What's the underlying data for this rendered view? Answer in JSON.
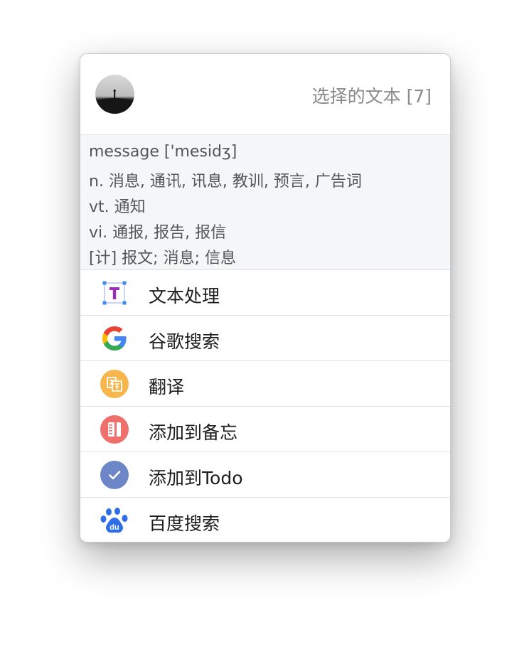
{
  "header": {
    "title": "选择的文本 [7]",
    "avatar_icon": "avatar-silhouette-icon"
  },
  "dictionary": {
    "lines": [
      "message ['mesidʒ]",
      "n. 消息, 通讯, 讯息, 教训, 预言, 广告词",
      "vt. 通知",
      "vi. 通报, 报告, 报信",
      "[计] 报文; 消息; 信息"
    ]
  },
  "menu": {
    "items": [
      {
        "label": "文本处理",
        "icon": "text-processing-icon"
      },
      {
        "label": "谷歌搜索",
        "icon": "google-icon"
      },
      {
        "label": "翻译",
        "icon": "translate-icon"
      },
      {
        "label": "添加到备忘",
        "icon": "memo-icon"
      },
      {
        "label": "添加到Todo",
        "icon": "todo-check-icon"
      },
      {
        "label": "百度搜索",
        "icon": "baidu-paw-icon"
      }
    ]
  },
  "colors": {
    "translate": "#f7b64b",
    "memo": "#ef6f6c",
    "todo": "#6c86c8",
    "baidu": "#2e6ee6",
    "text_processing": "#9b2fb5"
  }
}
